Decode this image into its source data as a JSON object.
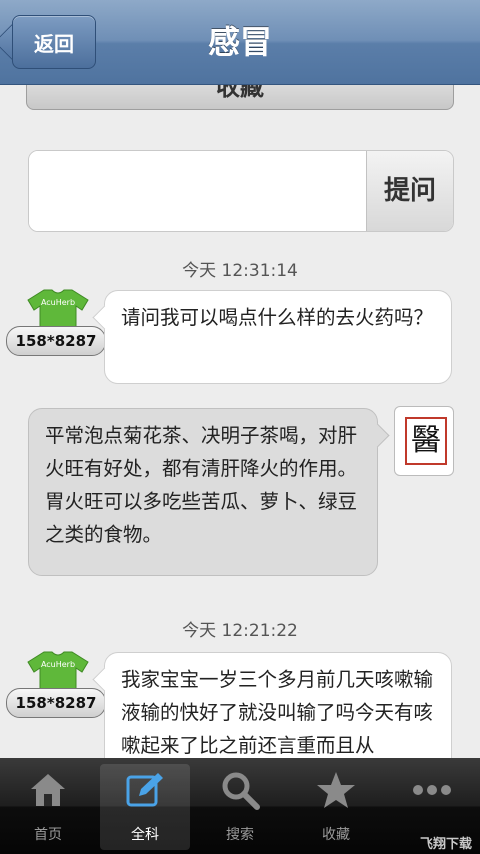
{
  "nav": {
    "back_label": "返回",
    "title": "感冒"
  },
  "favorite_label": "收藏",
  "ask": {
    "placeholder": "",
    "button_label": "提问"
  },
  "messages": [
    {
      "time": "今天 12:31:14",
      "sender": "158*8287",
      "user_text": "请问我可以喝点什么样的去火药吗？",
      "doctor_text": "平常泡点菊花茶、决明子茶喝，对肝火旺有好处，都有清肝降火的作用。胃火旺可以多吃些苦瓜、萝卜、绿豆之类的食物。"
    },
    {
      "time": "今天 12:21:22",
      "sender": "158*8287",
      "user_text": "我家宝宝一岁三个多月前几天咳嗽输液输的快好了就没叫输了吗今天有咳嗽起来了比之前还言重而且从"
    }
  ],
  "shirt_brand": "AcuHerb",
  "doctor_badge": "醫",
  "tabs": [
    {
      "label": "首页",
      "icon": "home-icon"
    },
    {
      "label": "全科",
      "icon": "edit-icon",
      "active": true
    },
    {
      "label": "搜索",
      "icon": "search-icon"
    },
    {
      "label": "收藏",
      "icon": "star-icon"
    },
    {
      "label": "",
      "icon": "more-icon"
    }
  ],
  "watermark": "飞翔下载",
  "colors": {
    "nav": "#5b7ea9",
    "shirt": "#5fb83a",
    "stamp": "#c0392b"
  }
}
